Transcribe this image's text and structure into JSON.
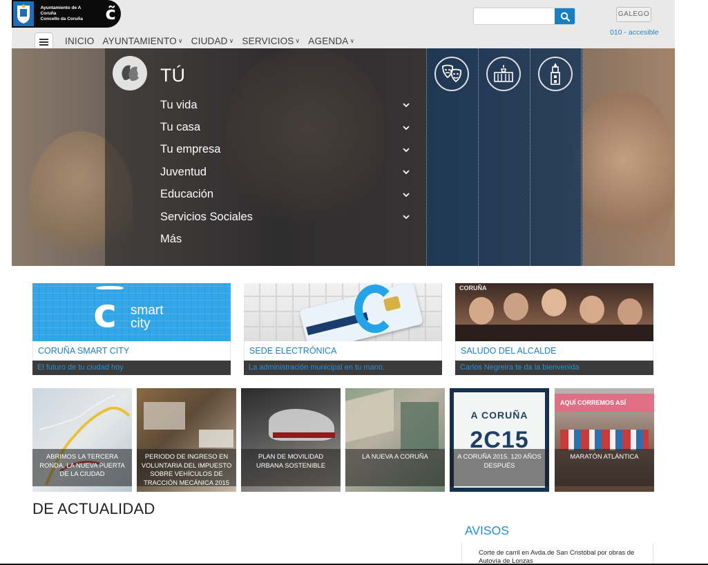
{
  "header": {
    "logo_text": [
      "Ayuntamiento de A Coruña",
      "Concello da Coruña"
    ],
    "logo_mark": "c̃",
    "search": {
      "placeholder": "",
      "value": ""
    },
    "lang_button": "GALEGO",
    "access_link": "010 - accesible",
    "nav": [
      {
        "label": "INICIO",
        "has_caret": false
      },
      {
        "label": "AYUNTAMIENTO",
        "has_caret": true
      },
      {
        "label": "CIUDAD",
        "has_caret": true
      },
      {
        "label": "SERVICIOS",
        "has_caret": true
      },
      {
        "label": "AGENDA",
        "has_caret": true
      }
    ]
  },
  "hero": {
    "title": "TÚ",
    "menu": [
      {
        "label": "Tu vida",
        "expandable": true
      },
      {
        "label": "Tu casa",
        "expandable": true
      },
      {
        "label": "Tu empresa",
        "expandable": true
      },
      {
        "label": "Juventud",
        "expandable": true
      },
      {
        "label": "Educación",
        "expandable": true
      },
      {
        "label": "Servicios Sociales",
        "expandable": true
      },
      {
        "label": "Más",
        "expandable": false
      }
    ],
    "icons": [
      "profile-faces-icon",
      "theater-masks-icon",
      "palace-icon",
      "tower-icon"
    ]
  },
  "cards": [
    {
      "title": "CORUÑA SMART CITY",
      "subtitle": "El futuro de tu ciudad hoy",
      "image_text": "smart city"
    },
    {
      "title": "SEDE ELECTRÓNICA",
      "subtitle": "La administración municipal en tu mano.",
      "image_text": ""
    },
    {
      "title": "SALUDO DEL ALCALDE",
      "subtitle": "Carlos Negreira te da la bienvenida",
      "image_text": "CORUÑA"
    }
  ],
  "tiles": [
    {
      "label": "ABRIMOS LA TERCERA RONDA, LA NUEVA PUERTA DE LA CIUDAD"
    },
    {
      "label": "PERIODO DE INGRESO EN VOLUNTARIA DEL IMPUESTO SOBRE VEHÍCULOS DE TRACCIÓN MECÁNICA 2015"
    },
    {
      "label": "PLAN DE MOVILIDAD URBANA SOSTENIBLE"
    },
    {
      "label": "LA NUEVA A CORUÑA"
    },
    {
      "label": "A CORUÑA 2015. 120 AÑOS DESPUÉS",
      "image_text": [
        "A CORUÑA",
        "2C15"
      ]
    },
    {
      "label": "MARATÓN ATLÁNTICA",
      "image_text": "AQUÍ CORREMOS ASÍ"
    }
  ],
  "sections": {
    "news_title": "DE ACTUALIDAD",
    "avisos_title": "AVISOS",
    "aviso_item": "Corte de carril en Avda.de San Cristóbal por obras de Autovía de Lonzas"
  },
  "colors": {
    "accent_blue": "#1f7fbd",
    "hero_blue_panel": "#163458",
    "dark_bar": "#3b3b3b"
  }
}
